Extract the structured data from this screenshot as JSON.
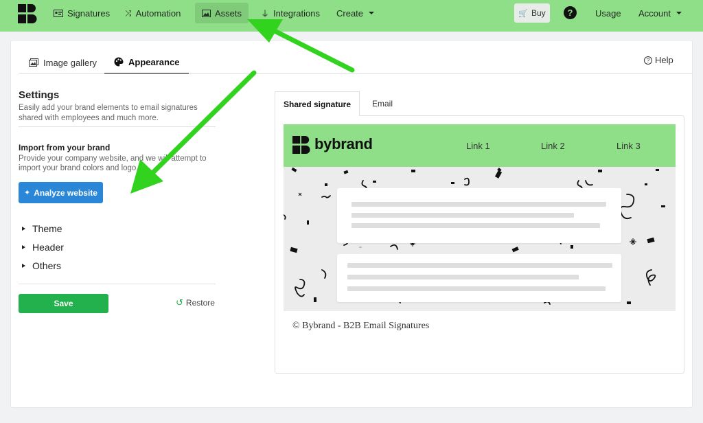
{
  "nav": {
    "items": [
      {
        "label": "Signatures",
        "icon": "id-card-icon"
      },
      {
        "label": "Automation",
        "icon": "shuffle-icon"
      },
      {
        "label": "Assets",
        "icon": "image-icon"
      },
      {
        "label": "Integrations",
        "icon": "plug-icon"
      },
      {
        "label": "Create",
        "icon": "chevron-down-icon"
      }
    ],
    "buy_label": "Buy",
    "help_glyph": "?",
    "usage_label": "Usage",
    "account_label": "Account",
    "accent_color": "#8fde88"
  },
  "tabs": {
    "image_gallery": "Image gallery",
    "appearance": "Appearance",
    "help": "Help"
  },
  "settings": {
    "title": "Settings",
    "description": "Easily add your brand elements to email signatures shared with employees and much more.",
    "import_title": "Import from your brand",
    "import_description": "Provide your company website, and we will attempt to import your brand colors and logo.",
    "analyze_button": "Analyze website",
    "sections": [
      "Theme",
      "Header",
      "Others"
    ],
    "save_button": "Save",
    "restore_link": "Restore"
  },
  "preview": {
    "tabs": [
      "Shared signature",
      "Email"
    ],
    "brand_name": "bybrand",
    "links": [
      "Link 1",
      "Link 2",
      "Link 3"
    ],
    "footer": "© Bybrand - B2B Email Signatures"
  }
}
